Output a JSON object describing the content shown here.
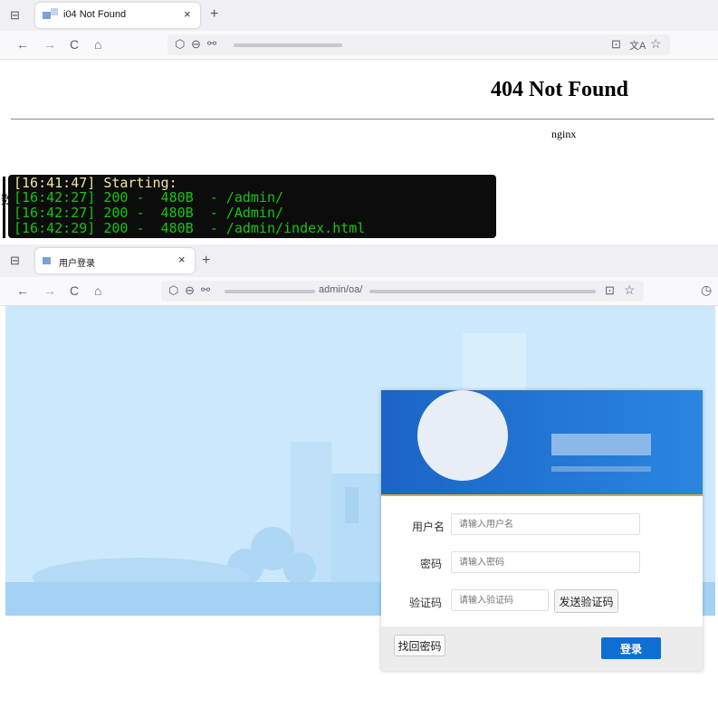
{
  "browser1": {
    "tab_title": "i04 Not Found",
    "tab_close": "×",
    "new_tab": "+",
    "nav": {
      "back": "←",
      "forward": "→",
      "reload": "C",
      "home": "⌂"
    },
    "toolbar": {
      "shield": "⬡",
      "lock": "⊖",
      "perm": "⚯",
      "save": "⊡",
      "translate": "文A",
      "star": "☆"
    }
  },
  "page404": {
    "heading": "404 Not Found",
    "server": "nginx"
  },
  "terminal": {
    "lines": [
      {
        "time": "[16:41:47]",
        "text": " Starting:"
      },
      {
        "time": "[16:42:27]",
        "text": " 200 -  480B  - /admin/"
      },
      {
        "time": "[16:42:27]",
        "text": " 200 -  480B  - /Admin/"
      },
      {
        "time": "[16:42:29]",
        "text": " 200 -  480B  - /admin/index.html"
      }
    ],
    "side_char": "数"
  },
  "browser2": {
    "tab_title": "用户登录",
    "tab_close": "×",
    "new_tab": "+",
    "url_visible": "admin/oa/",
    "nav": {
      "back": "←",
      "forward": "→",
      "reload": "C",
      "home": "⌂"
    },
    "toolbar": {
      "shield": "⬡",
      "lock": "⊖",
      "perm": "⚯",
      "save": "⊡",
      "star": "☆",
      "clock": "◷"
    }
  },
  "login": {
    "username_label": "用户名",
    "username_placeholder": "请输入用户名",
    "password_label": "密码",
    "password_placeholder": "请输入密码",
    "captcha_label": "验证码",
    "captcha_placeholder": "请输入验证码",
    "send_code": "发送验证码",
    "forgot": "找回密码",
    "submit": "登录"
  },
  "colors": {
    "accent": "#0e6fd1",
    "banner": "#1b64c6",
    "background": "#cbe8fc",
    "terminal_green": "#16c60c"
  }
}
